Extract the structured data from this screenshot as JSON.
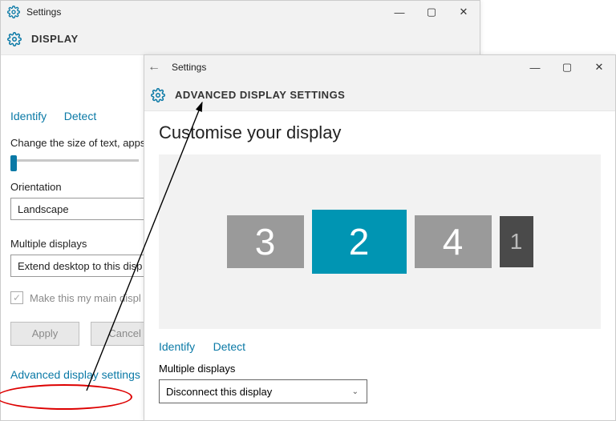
{
  "winBack": {
    "title": "Settings",
    "header": "DISPLAY",
    "identify": "Identify",
    "detect": "Detect",
    "sizeText": "Change the size of text, apps",
    "orientationLabel": "Orientation",
    "orientationValue": "Landscape",
    "multiLabel": "Multiple displays",
    "multiValue": "Extend desktop to this disp",
    "mainDisplay": "Make this my main displ",
    "apply": "Apply",
    "cancel": "Cancel",
    "advLink": "Advanced display settings"
  },
  "winFront": {
    "title": "Settings",
    "header": "ADVANCED DISPLAY SETTINGS",
    "customise": "Customise your display",
    "monitors": [
      "3",
      "2",
      "4",
      "1"
    ],
    "identify": "Identify",
    "detect": "Detect",
    "multiLabel": "Multiple displays",
    "multiValue": "Disconnect this display"
  }
}
